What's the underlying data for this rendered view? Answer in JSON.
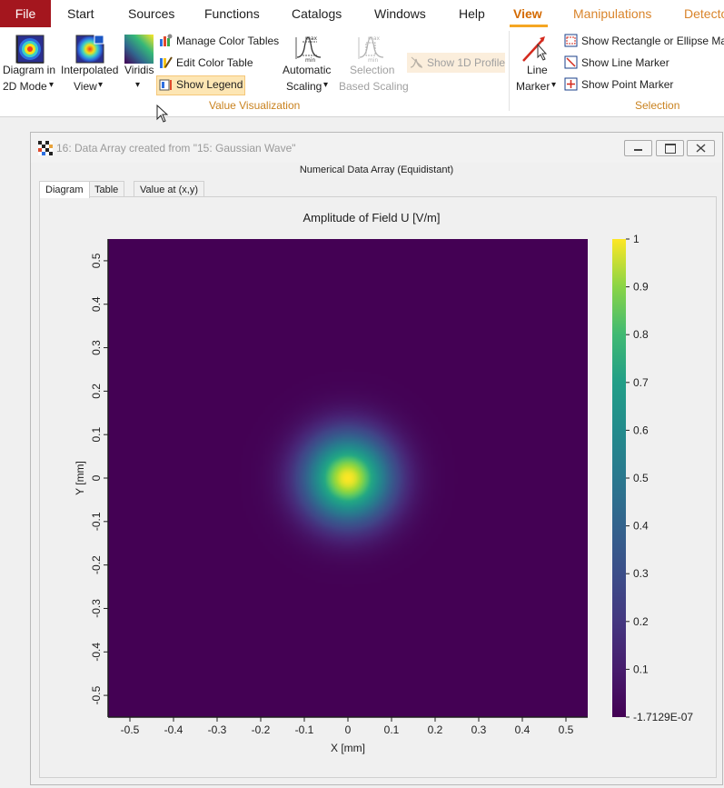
{
  "menu": {
    "file": "File",
    "start": "Start",
    "sources": "Sources",
    "functions": "Functions",
    "catalogs": "Catalogs",
    "windows": "Windows",
    "help": "Help",
    "view": "View",
    "manipulations": "Manipulations",
    "detectors": "Detecto"
  },
  "ribbon": {
    "diagram_mode": {
      "line1": "Diagram in",
      "line2": "2D Mode"
    },
    "interpolated_view": {
      "line1": "Interpolated",
      "line2": "View"
    },
    "viridis": "Viridis",
    "manage_color_tables": "Manage Color Tables",
    "edit_color_table": "Edit Color Table",
    "show_legend": "Show Legend",
    "automatic_scaling": {
      "line1": "Automatic",
      "line2": "Scaling"
    },
    "selection_based_scaling": {
      "line1": "Selection",
      "line2": "Based Scaling"
    },
    "show_1d_profile": "Show 1D Profile",
    "value_visualization_group": "Value Visualization",
    "line_marker": {
      "line1": "Line",
      "line2": "Marker"
    },
    "show_rect_ellipse_marker": "Show Rectangle or Ellipse Mar",
    "show_line_marker": "Show Line Marker",
    "show_point_marker": "Show Point Marker",
    "selection_group": "Selection",
    "dropdown_arrow": "▾"
  },
  "window": {
    "title": "16: Data Array created from \"15: Gaussian Wave\"",
    "subtitle": "Numerical Data Array (Equidistant)",
    "tabs": [
      "Diagram",
      "Table",
      "Value at (x,y)"
    ],
    "active_tab": "Diagram"
  },
  "chart_data": {
    "type": "heatmap",
    "title": "Amplitude of Field U  [V/m]",
    "xlabel": "X [mm]",
    "ylabel": "Y [mm]",
    "xlim": [
      -0.55,
      0.55
    ],
    "ylim": [
      -0.55,
      0.55
    ],
    "xticks": [
      -0.5,
      -0.4,
      -0.3,
      -0.2,
      -0.1,
      0,
      0.1,
      0.2,
      0.3,
      0.4,
      0.5
    ],
    "yticks": [
      -0.5,
      -0.4,
      -0.3,
      -0.2,
      -0.1,
      0,
      0.1,
      0.2,
      0.3,
      0.4,
      0.5
    ],
    "colormap": "viridis",
    "colorbar_min": -1.7129e-07,
    "colorbar_max": 1,
    "colorbar_ticks": [
      "1",
      "0.9",
      "0.8",
      "0.7",
      "0.6",
      "0.5",
      "0.4",
      "0.3",
      "0.2",
      "0.1",
      "-1.7129E-07"
    ],
    "colorbar_tick_values": [
      1,
      0.9,
      0.8,
      0.7,
      0.6,
      0.5,
      0.4,
      0.3,
      0.2,
      0.1,
      -1.7129e-07
    ],
    "field": {
      "kind": "gaussian",
      "center_x": 0,
      "center_y": 0,
      "waist_mm": 0.1,
      "peak": 1
    }
  },
  "colors": {
    "file_menu_bg": "#a4161e",
    "view_accent": "#d46a00",
    "group_label": "#c9821f",
    "highlight": "#fde6b4"
  }
}
